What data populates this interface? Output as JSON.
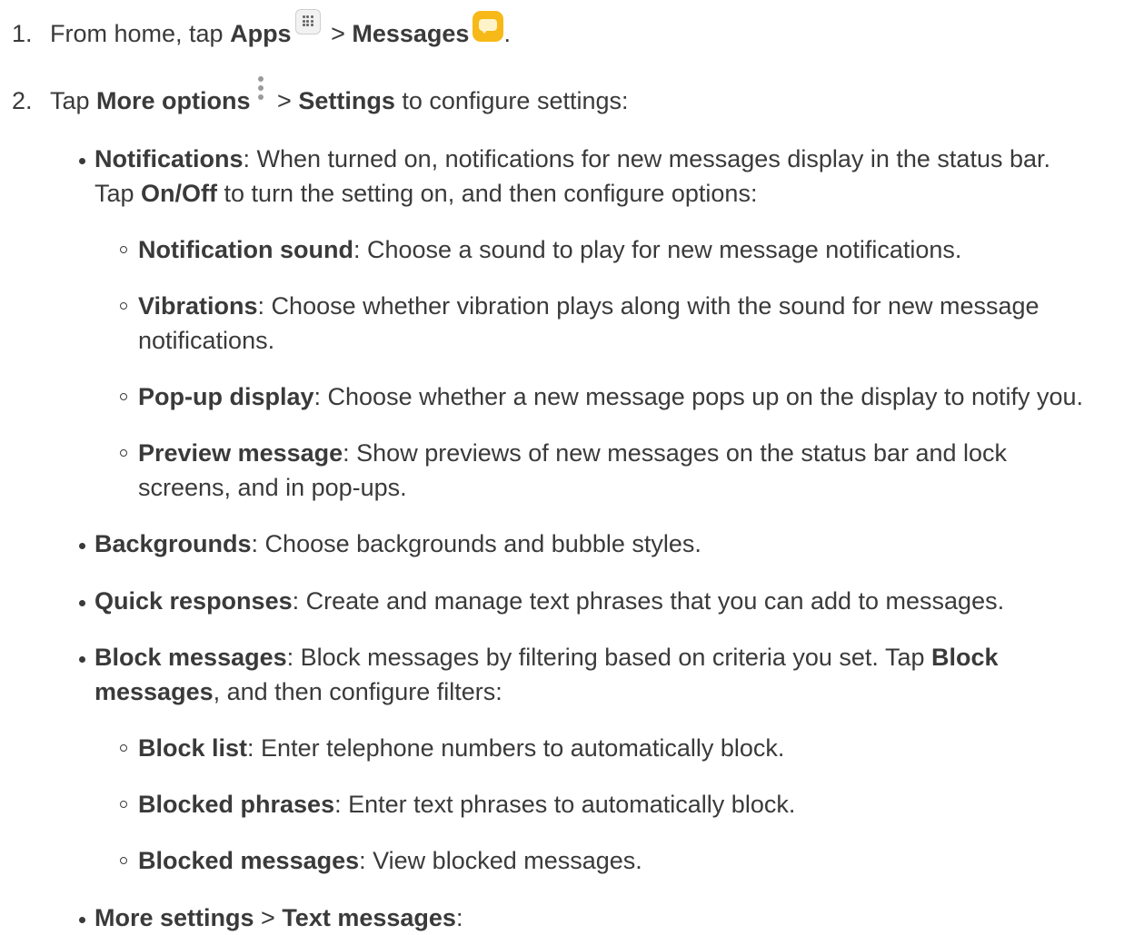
{
  "steps": [
    {
      "number": "1.",
      "pre": "From home, tap ",
      "apps": "Apps",
      "sep": " > ",
      "messages": "Messages",
      "post": "."
    },
    {
      "number": "2.",
      "pre": "Tap ",
      "more_options": "More options",
      "sep": " > ",
      "settings": "Settings",
      "post": " to configure settings:"
    }
  ],
  "notifications": {
    "title": "Notifications",
    "text1": ": When turned on, notifications for new messages display in the status bar.",
    "text2_pre": "Tap ",
    "onoff": "On/Off",
    "text2_post": " to turn the setting on, and then configure options:",
    "sub": [
      {
        "title": "Notification sound",
        "text": ": Choose a sound to play for new message notifications."
      },
      {
        "title": "Vibrations",
        "text": ": Choose whether vibration plays along with the sound for new message",
        "text2": "notifications."
      },
      {
        "title": "Pop-up display",
        "text": ": Choose whether a new message pops up on the display to notify you."
      },
      {
        "title": "Preview message",
        "text": ": Show previews of new messages on the status bar and lock",
        "text2": "screens, and in pop-ups."
      }
    ]
  },
  "backgrounds": {
    "title": "Backgrounds",
    "text": ": Choose backgrounds and bubble styles."
  },
  "quick_responses": {
    "title": "Quick responses",
    "text": ": Create and manage text phrases that you can add to messages."
  },
  "block_messages": {
    "title": "Block messages",
    "text1": ": Block messages by filtering based on criteria you set. Tap ",
    "bold1": "Block",
    "bold2": "messages",
    "text2": ", and then configure filters:",
    "sub": [
      {
        "title": "Block list",
        "text": ": Enter telephone numbers to automatically block."
      },
      {
        "title": "Blocked phrases",
        "text": ": Enter text phrases to automatically block."
      },
      {
        "title": "Blocked messages",
        "text": ": View blocked messages."
      }
    ]
  },
  "more_settings": {
    "title": "More settings",
    "sep": " > ",
    "title2": "Text messages",
    "post": ":"
  }
}
